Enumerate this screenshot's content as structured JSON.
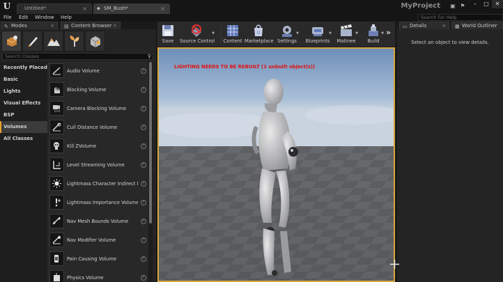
{
  "titlebar": {
    "tabs": [
      {
        "label": "Untitled*",
        "active": false
      },
      {
        "label": "SM_Bush*",
        "active": true
      }
    ],
    "project_name": "MyProject",
    "help_search_placeholder": "Search For Help"
  },
  "menu": [
    "File",
    "Edit",
    "Window",
    "Help"
  ],
  "panel_tabs": {
    "modes": "Modes",
    "content_browser": "Content Browser",
    "details": "Details",
    "world_outliner": "World Outliner"
  },
  "modes": {
    "search_placeholder": "Search Classes",
    "categories": [
      {
        "label": "Recently Placed",
        "selected": false
      },
      {
        "label": "Basic",
        "selected": false
      },
      {
        "label": "Lights",
        "selected": false
      },
      {
        "label": "Visual Effects",
        "selected": false
      },
      {
        "label": "BSP",
        "selected": false
      },
      {
        "label": "Volumes",
        "selected": true
      },
      {
        "label": "All Classes",
        "selected": false
      }
    ],
    "items": [
      {
        "label": "Audio Volume",
        "icon": "audio-volume-icon"
      },
      {
        "label": "Blocking Volume",
        "icon": "blocking-volume-icon"
      },
      {
        "label": "Camera Blocking Volume",
        "icon": "camera-blocking-volume-icon"
      },
      {
        "label": "Cull Distance Volume",
        "icon": "cull-distance-volume-icon"
      },
      {
        "label": "Kill ZVolume",
        "icon": "kill-zvolume-icon"
      },
      {
        "label": "Level Streaming Volume",
        "icon": "level-streaming-volume-icon"
      },
      {
        "label": "Lightmass Character Indirect D",
        "icon": "lightmass-character-icon"
      },
      {
        "label": "Lightmass Importance Volume",
        "icon": "lightmass-importance-icon"
      },
      {
        "label": "Nav Mesh Bounds Volume",
        "icon": "nav-mesh-bounds-icon"
      },
      {
        "label": "Nav Modifier Volume",
        "icon": "nav-modifier-icon"
      },
      {
        "label": "Pain Causing Volume",
        "icon": "pain-causing-icon"
      },
      {
        "label": "Physics Volume",
        "icon": "physics-volume-icon"
      }
    ]
  },
  "toolbar": {
    "save": "Save",
    "source_control": "Source Control",
    "content": "Content",
    "marketplace": "Marketplace",
    "settings": "Settings",
    "blueprints": "Blueprints",
    "matinee": "Matinee",
    "build": "Build"
  },
  "viewport": {
    "lighting_warning": "LIGHTING NEEDS TO BE REBUILT (1 unbuilt object(s))"
  },
  "details": {
    "empty_message": "Select an object to view details."
  },
  "colors": {
    "accent": "#e8a22c",
    "warning_text": "#e01010",
    "background": "#242424"
  }
}
